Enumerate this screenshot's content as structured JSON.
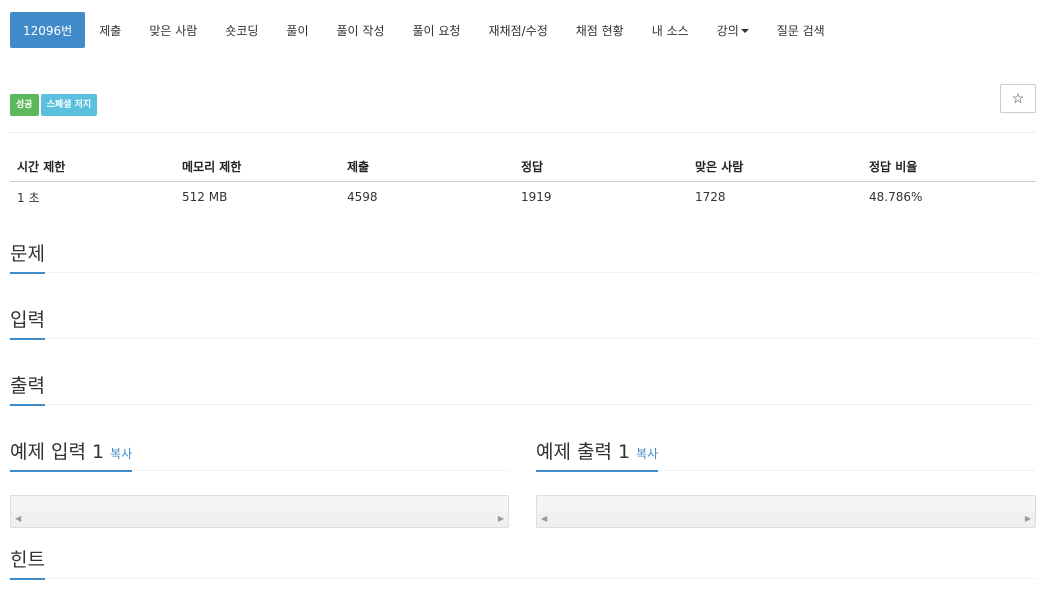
{
  "nav": {
    "items": [
      {
        "label": "12096번",
        "active": true
      },
      {
        "label": "제출"
      },
      {
        "label": "맞은 사람"
      },
      {
        "label": "숏코딩"
      },
      {
        "label": "풀이"
      },
      {
        "label": "풀이 작성"
      },
      {
        "label": "풀이 요청"
      },
      {
        "label": "재채점/수정"
      },
      {
        "label": "채점 현황"
      },
      {
        "label": "내 소스"
      },
      {
        "label": "강의",
        "dropdown": true
      },
      {
        "label": "질문 검색"
      }
    ]
  },
  "badges": {
    "success": "성공",
    "special_judge": "스페셜 저지"
  },
  "star": "☆",
  "info_table": {
    "headers": [
      "시간 제한",
      "메모리 제한",
      "제출",
      "정답",
      "맞은 사람",
      "정답 비율"
    ],
    "values": [
      "1 초",
      "512 MB",
      "4598",
      "1919",
      "1728",
      "48.786%"
    ]
  },
  "sections": {
    "problem": "문제",
    "input": "입력",
    "output": "출력",
    "sample_input": "예제 입력 1",
    "sample_output": "예제 출력 1",
    "copy": "복사",
    "hint": "힌트"
  },
  "colors": {
    "primary": "#428bca",
    "success": "#5cb85c",
    "info": "#5bc0de"
  }
}
